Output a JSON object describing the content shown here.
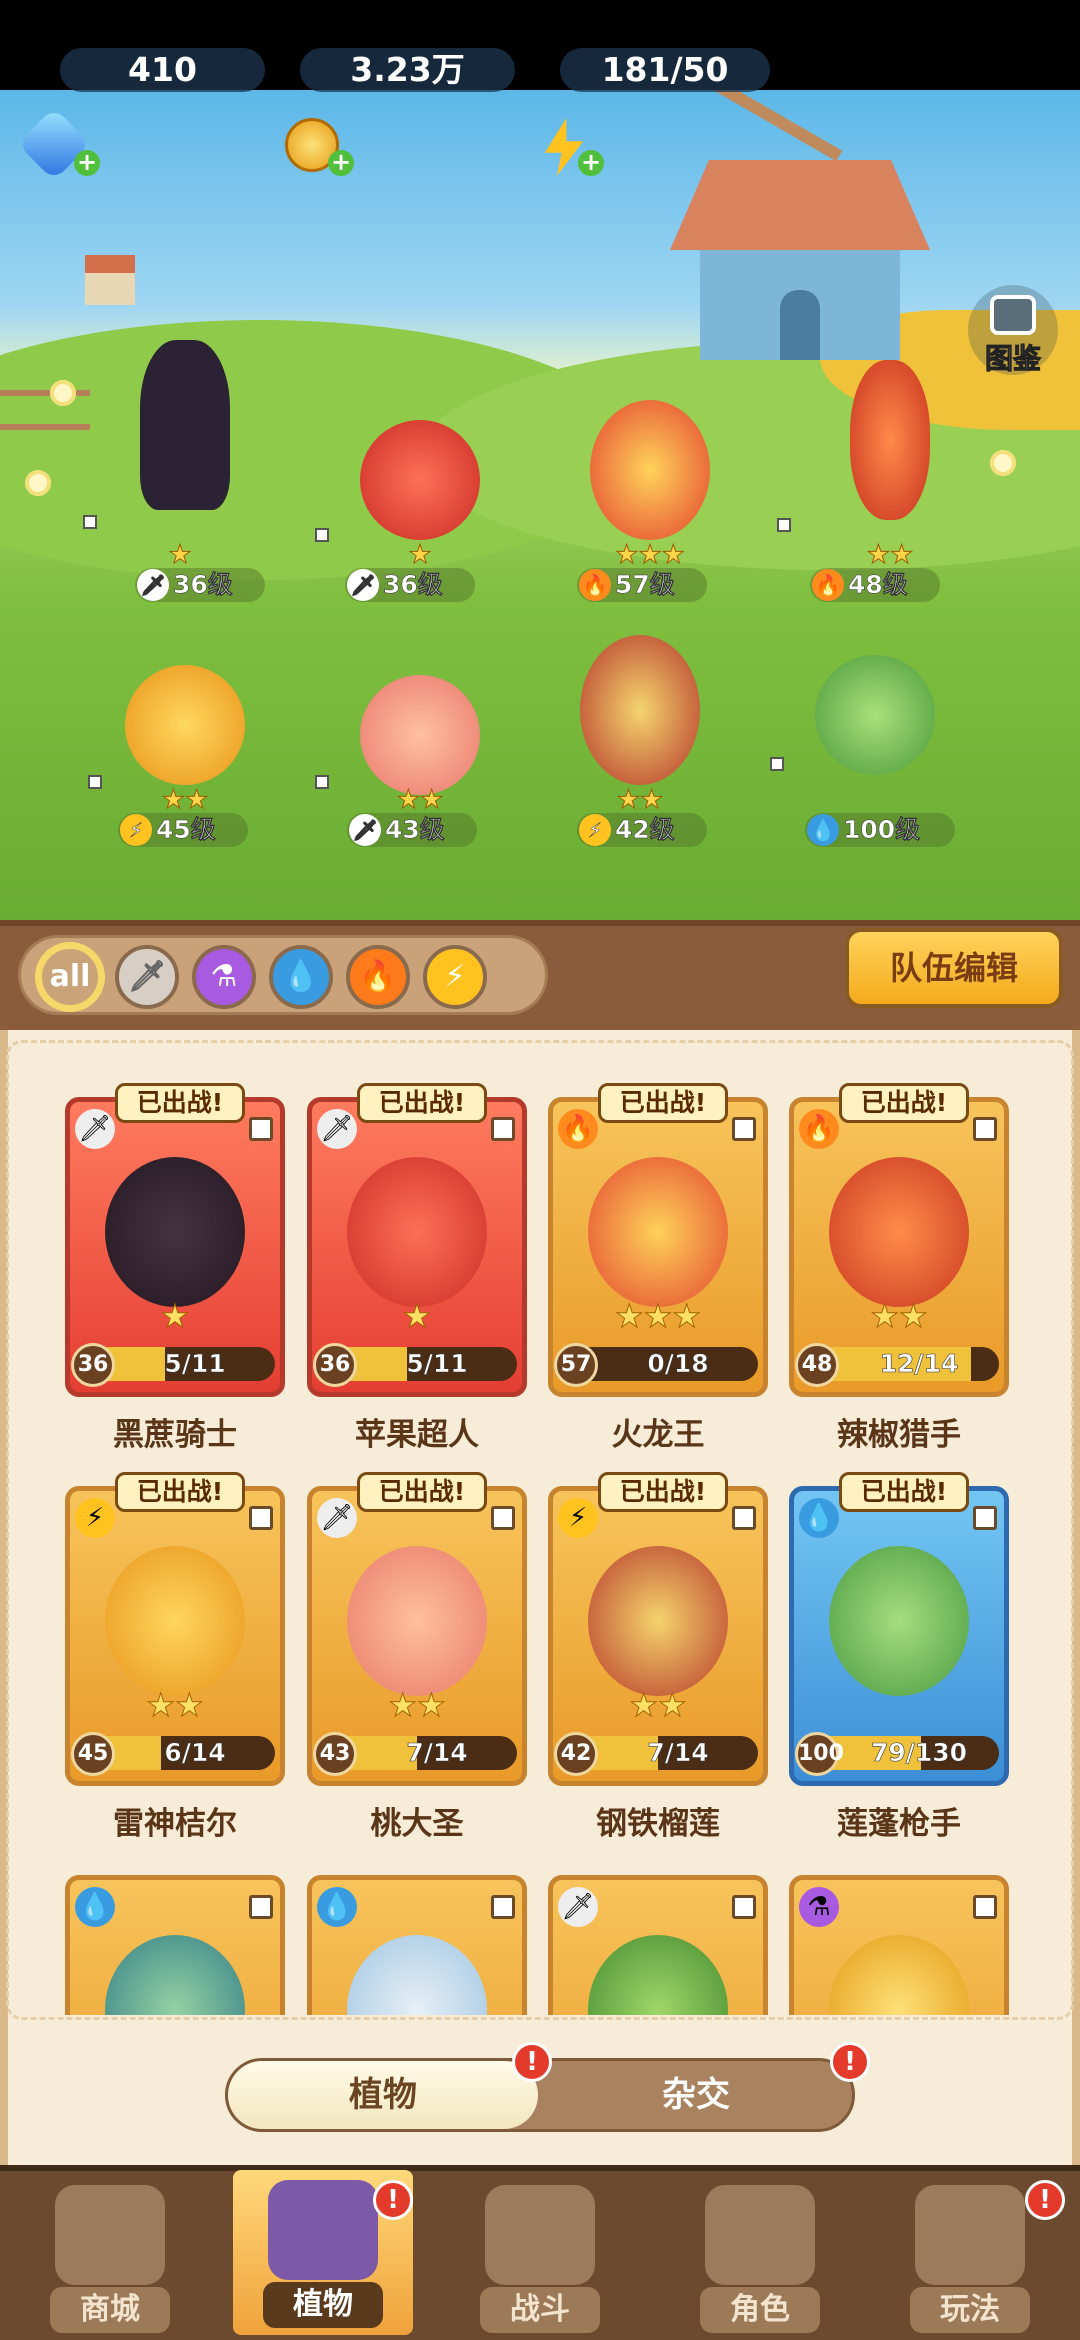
{
  "currencies": {
    "diamonds": "410",
    "gold": "3.23万",
    "energy": "181/50"
  },
  "codex_label": "图鉴",
  "scene_team": [
    {
      "level": "36级",
      "element": "sword",
      "stars": "★"
    },
    {
      "level": "36级",
      "element": "sword",
      "stars": "★"
    },
    {
      "level": "57级",
      "element": "fire",
      "stars": "★★★"
    },
    {
      "level": "48级",
      "element": "fire",
      "stars": "★★"
    },
    {
      "level": "45级",
      "element": "lightning",
      "stars": "★★"
    },
    {
      "level": "43级",
      "element": "sword",
      "stars": "★★"
    },
    {
      "level": "42级",
      "element": "lightning",
      "stars": "★★"
    },
    {
      "level": "100级",
      "element": "water",
      "stars": ""
    }
  ],
  "filters": [
    "all",
    "sword-icon",
    "poison-icon",
    "water-icon",
    "fire-icon",
    "lightning-icon"
  ],
  "team_edit_label": "队伍编辑",
  "deployed_label": "已出战!",
  "cards": [
    {
      "name": "黑蔗骑士",
      "level": "36",
      "progress": "5/11",
      "fill": 0.45,
      "stars": "★",
      "element": "sword",
      "color": "red"
    },
    {
      "name": "苹果超人",
      "level": "36",
      "progress": "5/11",
      "fill": 0.45,
      "stars": "★",
      "element": "sword",
      "color": "red"
    },
    {
      "name": "火龙王",
      "level": "57",
      "progress": "0/18",
      "fill": 0.0,
      "stars": "★★★",
      "element": "fire",
      "color": "gold"
    },
    {
      "name": "辣椒猎手",
      "level": "48",
      "progress": "12/14",
      "fill": 0.86,
      "stars": "★★",
      "element": "fire",
      "color": "gold"
    },
    {
      "name": "雷神桔尔",
      "level": "45",
      "progress": "6/14",
      "fill": 0.43,
      "stars": "★★",
      "element": "lightning",
      "color": "gold"
    },
    {
      "name": "桃大圣",
      "level": "43",
      "progress": "7/14",
      "fill": 0.5,
      "stars": "★★",
      "element": "sword",
      "color": "gold"
    },
    {
      "name": "钢铁榴莲",
      "level": "42",
      "progress": "7/14",
      "fill": 0.5,
      "stars": "★★",
      "element": "lightning",
      "color": "gold"
    },
    {
      "name": "莲蓬枪手",
      "level": "100",
      "progress": "79/130",
      "fill": 0.61,
      "stars": "",
      "element": "water",
      "color": "blue"
    }
  ],
  "tabs": {
    "active": "植物",
    "other": "杂交"
  },
  "nav": [
    "商城",
    "植物",
    "战斗",
    "角色",
    "玩法"
  ],
  "colors": {
    "accent": "#f4aa1c",
    "board": "#8a5c3c",
    "panel": "#f6ecd7"
  }
}
